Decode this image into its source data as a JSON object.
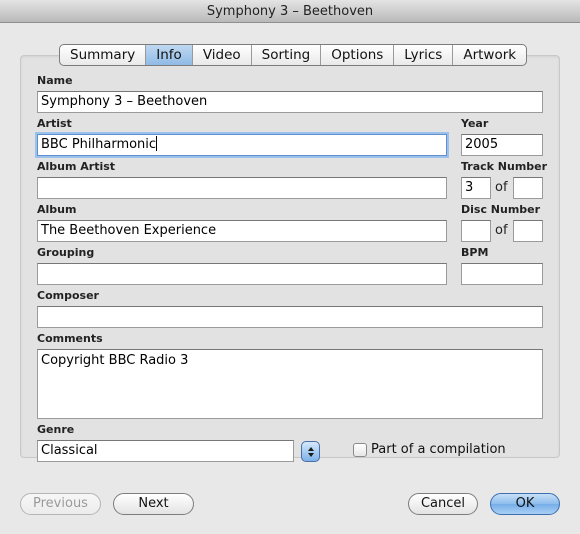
{
  "window": {
    "title": "Symphony 3 – Beethoven"
  },
  "tabs": [
    {
      "label": "Summary",
      "active": false
    },
    {
      "label": "Info",
      "active": true
    },
    {
      "label": "Video",
      "active": false
    },
    {
      "label": "Sorting",
      "active": false
    },
    {
      "label": "Options",
      "active": false
    },
    {
      "label": "Lyrics",
      "active": false
    },
    {
      "label": "Artwork",
      "active": false
    }
  ],
  "fields": {
    "name": {
      "label": "Name",
      "value": "Symphony 3 – Beethoven"
    },
    "artist": {
      "label": "Artist",
      "value": "BBC Philharmonic"
    },
    "year": {
      "label": "Year",
      "value": "2005"
    },
    "album_artist": {
      "label": "Album Artist",
      "value": ""
    },
    "track_number": {
      "label": "Track Number",
      "value": "3",
      "of_label": "of",
      "total": ""
    },
    "album": {
      "label": "Album",
      "value": "The Beethoven Experience"
    },
    "disc_number": {
      "label": "Disc Number",
      "value": "",
      "of_label": "of",
      "total": ""
    },
    "grouping": {
      "label": "Grouping",
      "value": ""
    },
    "bpm": {
      "label": "BPM",
      "value": ""
    },
    "composer": {
      "label": "Composer",
      "value": ""
    },
    "comments": {
      "label": "Comments",
      "value": "Copyright BBC Radio 3"
    },
    "genre": {
      "label": "Genre",
      "value": "Classical"
    },
    "compilation": {
      "label": "Part of a compilation",
      "checked": false
    }
  },
  "buttons": {
    "previous": "Previous",
    "next": "Next",
    "cancel": "Cancel",
    "ok": "OK"
  },
  "colors": {
    "accent": "#8fbbe6",
    "focus_ring": "#9cc1ea"
  }
}
